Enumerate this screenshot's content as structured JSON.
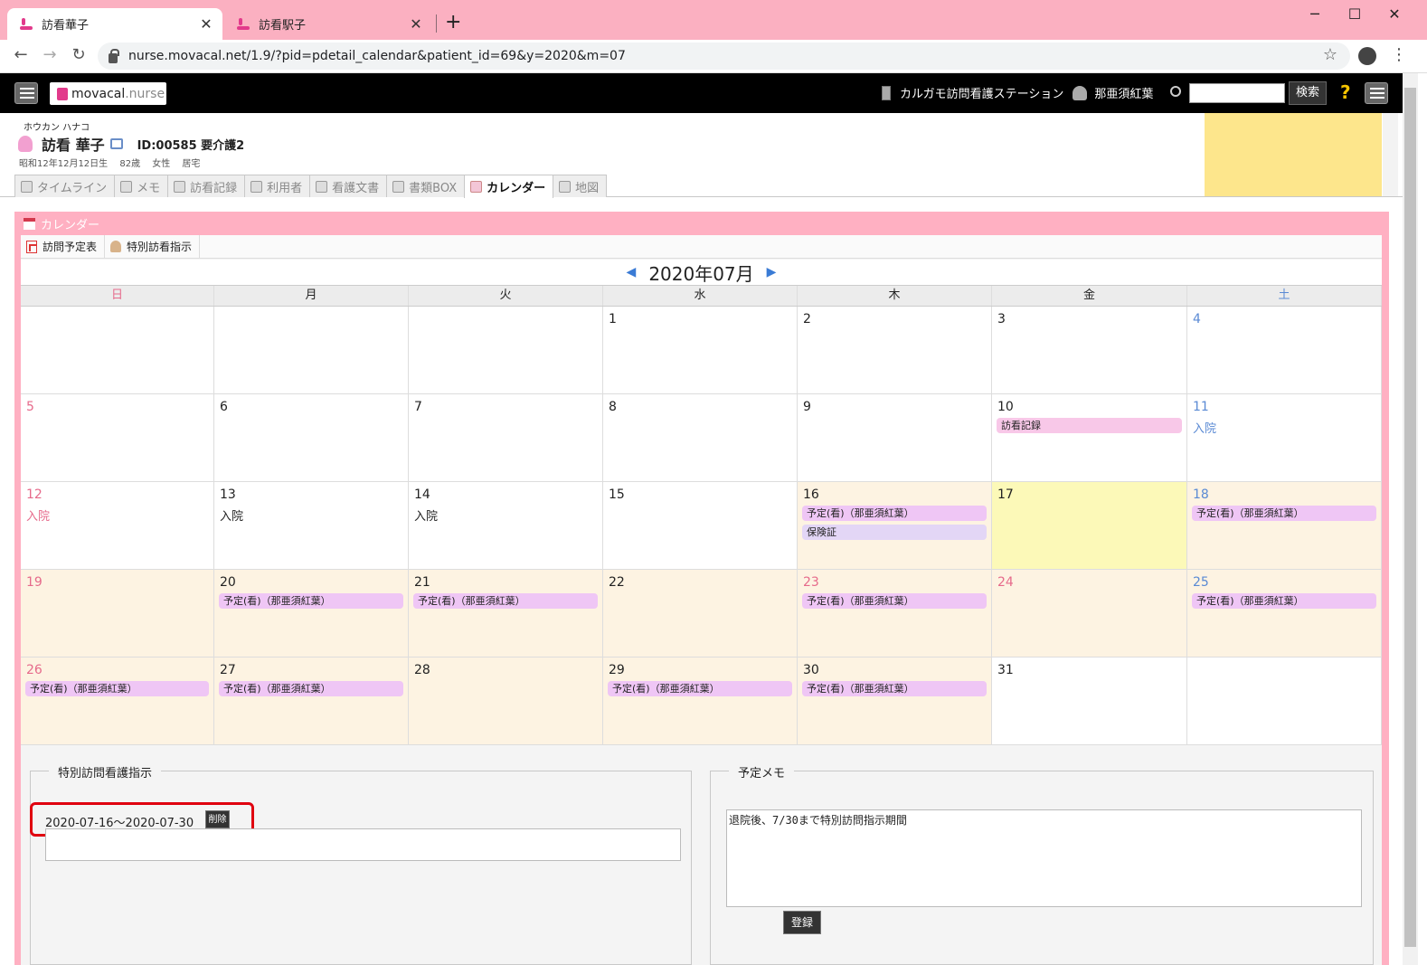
{
  "browser": {
    "tabs": [
      {
        "title": "訪看華子"
      },
      {
        "title": "訪看駅子"
      }
    ],
    "url": "nurse.movacal.net/1.9/?pid=pdetail_calendar&patient_id=69&y=2020&m=07"
  },
  "header": {
    "logo_main": "movacal",
    "logo_sub": ".nurse",
    "station": "カルガモ訪問看護ステーション",
    "user": "那亜須紅葉",
    "search_button": "検索",
    "help": "?"
  },
  "patient": {
    "kana": "ホウカン ハナコ",
    "name": "訪看 華子",
    "id_care": "ID:00585 要介護2",
    "info": "昭和12年12月12日生 82歳 女性 居宅",
    "tabs": [
      "タイムライン",
      "メモ",
      "訪看記録",
      "利用者",
      "看護文書",
      "書類BOX",
      "カレンダー",
      "地図"
    ],
    "active_tab": "カレンダー"
  },
  "calendar": {
    "panel_title": "カレンダー",
    "buttons": [
      "訪問予定表",
      "特別訪看指示"
    ],
    "month_label": "2020年07月",
    "weekdays": [
      "日",
      "月",
      "火",
      "水",
      "木",
      "金",
      "土"
    ],
    "weeks": [
      [
        {
          "day": "",
          "kind": "sun"
        },
        {
          "day": ""
        },
        {
          "day": ""
        },
        {
          "day": "1"
        },
        {
          "day": "2"
        },
        {
          "day": "3"
        },
        {
          "day": "4",
          "kind": "sat"
        }
      ],
      [
        {
          "day": "5",
          "kind": "sun"
        },
        {
          "day": "6"
        },
        {
          "day": "7"
        },
        {
          "day": "8"
        },
        {
          "day": "9"
        },
        {
          "day": "10",
          "events": [
            {
              "label": "訪看記録",
              "style": "rec"
            }
          ]
        },
        {
          "day": "11",
          "kind": "sat",
          "note": "入院"
        }
      ],
      [
        {
          "day": "12",
          "kind": "sun",
          "note": "入院"
        },
        {
          "day": "13",
          "note": "入院"
        },
        {
          "day": "14",
          "note": "入院"
        },
        {
          "day": "15"
        },
        {
          "day": "16",
          "bg": "tan",
          "events": [
            {
              "label": "予定(看)（那亜須紅葉）",
              "style": "pink"
            },
            {
              "label": "保険証",
              "style": "lilac"
            }
          ]
        },
        {
          "day": "17",
          "bg": "today"
        },
        {
          "day": "18",
          "kind": "sat",
          "bg": "tan",
          "events": [
            {
              "label": "予定(看)（那亜須紅葉）",
              "style": "pink"
            }
          ]
        }
      ],
      [
        {
          "day": "19",
          "kind": "sun",
          "bg": "tan"
        },
        {
          "day": "20",
          "bg": "tan",
          "events": [
            {
              "label": "予定(看)（那亜須紅葉）",
              "style": "pink"
            }
          ]
        },
        {
          "day": "21",
          "bg": "tan",
          "events": [
            {
              "label": "予定(看)（那亜須紅葉）",
              "style": "pink"
            }
          ]
        },
        {
          "day": "22",
          "bg": "tan"
        },
        {
          "day": "23",
          "kind": "hol",
          "bg": "tan",
          "events": [
            {
              "label": "予定(看)（那亜須紅葉）",
              "style": "pink"
            }
          ]
        },
        {
          "day": "24",
          "kind": "hol",
          "bg": "tan"
        },
        {
          "day": "25",
          "kind": "sat",
          "bg": "tan",
          "events": [
            {
              "label": "予定(看)（那亜須紅葉）",
              "style": "pink"
            }
          ]
        }
      ],
      [
        {
          "day": "26",
          "kind": "sun",
          "bg": "tan",
          "events": [
            {
              "label": "予定(看)（那亜須紅葉）",
              "style": "pink"
            }
          ]
        },
        {
          "day": "27",
          "bg": "tan",
          "events": [
            {
              "label": "予定(看)（那亜須紅葉）",
              "style": "pink"
            }
          ]
        },
        {
          "day": "28",
          "bg": "tan"
        },
        {
          "day": "29",
          "bg": "tan",
          "events": [
            {
              "label": "予定(看)（那亜須紅葉）",
              "style": "pink"
            }
          ]
        },
        {
          "day": "30",
          "bg": "tan",
          "events": [
            {
              "label": "予定(看)（那亜須紅葉）",
              "style": "pink"
            }
          ]
        },
        {
          "day": "31"
        },
        {
          "day": ""
        }
      ]
    ]
  },
  "special_instruction": {
    "legend": "特別訪問看護指示",
    "range": "2020-07-16～2020-07-30",
    "delete_button": "削除",
    "textarea_value": ""
  },
  "schedule_memo": {
    "legend": "予定メモ",
    "textarea_value": "退院後、7/30まで特別訪問指示期間",
    "register_button": "登録"
  }
}
